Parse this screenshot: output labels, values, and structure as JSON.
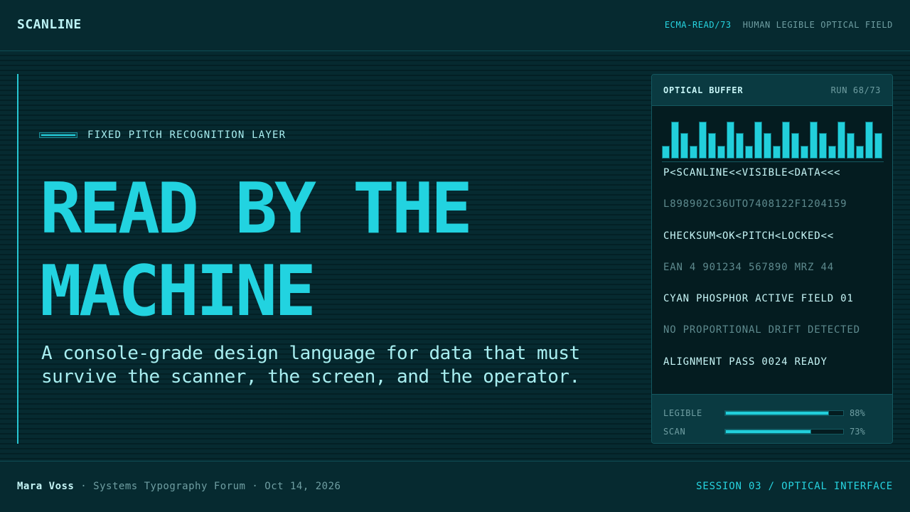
{
  "header": {
    "brand": "SCANLINE",
    "code": "ECMA-READ/73",
    "description": "HUMAN LEGIBLE OPTICAL FIELD"
  },
  "hero": {
    "eyebrow": "FIXED PITCH RECOGNITION LAYER",
    "headline_line1": "READ BY THE",
    "headline_line2": "MACHINE",
    "subhead": "A console-grade design language for data that must survive the scanner, the screen, and the operator."
  },
  "panel": {
    "title": "OPTICAL BUFFER",
    "run": "RUN 68/73",
    "bar_levels": [
      0.35,
      1.0,
      0.7,
      0.35,
      1.0,
      0.7,
      0.35,
      1.0,
      0.7,
      0.35,
      1.0,
      0.7,
      0.35,
      1.0,
      0.7,
      0.35,
      1.0,
      0.7,
      0.35,
      1.0,
      0.7,
      0.35,
      1.0,
      0.7
    ],
    "lines": [
      {
        "text": "P<SCANLINE<<VISIBLE<DATA<<<",
        "tone": "bright"
      },
      {
        "text": "L898902C36UTO7408122F1204159",
        "tone": "dim"
      },
      {
        "text": "CHECKSUM<OK<PITCH<LOCKED<<",
        "tone": "bright"
      },
      {
        "text": "EAN 4 901234 567890 MRZ 44",
        "tone": "dim"
      },
      {
        "text": "CYAN PHOSPHOR ACTIVE FIELD 01",
        "tone": "bright"
      },
      {
        "text": "NO PROPORTIONAL DRIFT DETECTED",
        "tone": "dim"
      },
      {
        "text": "ALIGNMENT PASS 0024 READY",
        "tone": "bright"
      }
    ],
    "meters": [
      {
        "label": "LEGIBLE",
        "value": 0.88,
        "value_text": "88%"
      },
      {
        "label": "SCAN",
        "value": 0.73,
        "value_text": "73%"
      }
    ]
  },
  "footer": {
    "name": "Mara Voss",
    "separator": "·",
    "event": "Systems Typography Forum",
    "date": "Oct 14, 2026",
    "session": "SESSION 03 / OPTICAL INTERFACE"
  },
  "colors": {
    "background": "#062a30",
    "accent": "#22d3e0",
    "text": "#a8eef0",
    "muted": "#6f9ea2"
  }
}
